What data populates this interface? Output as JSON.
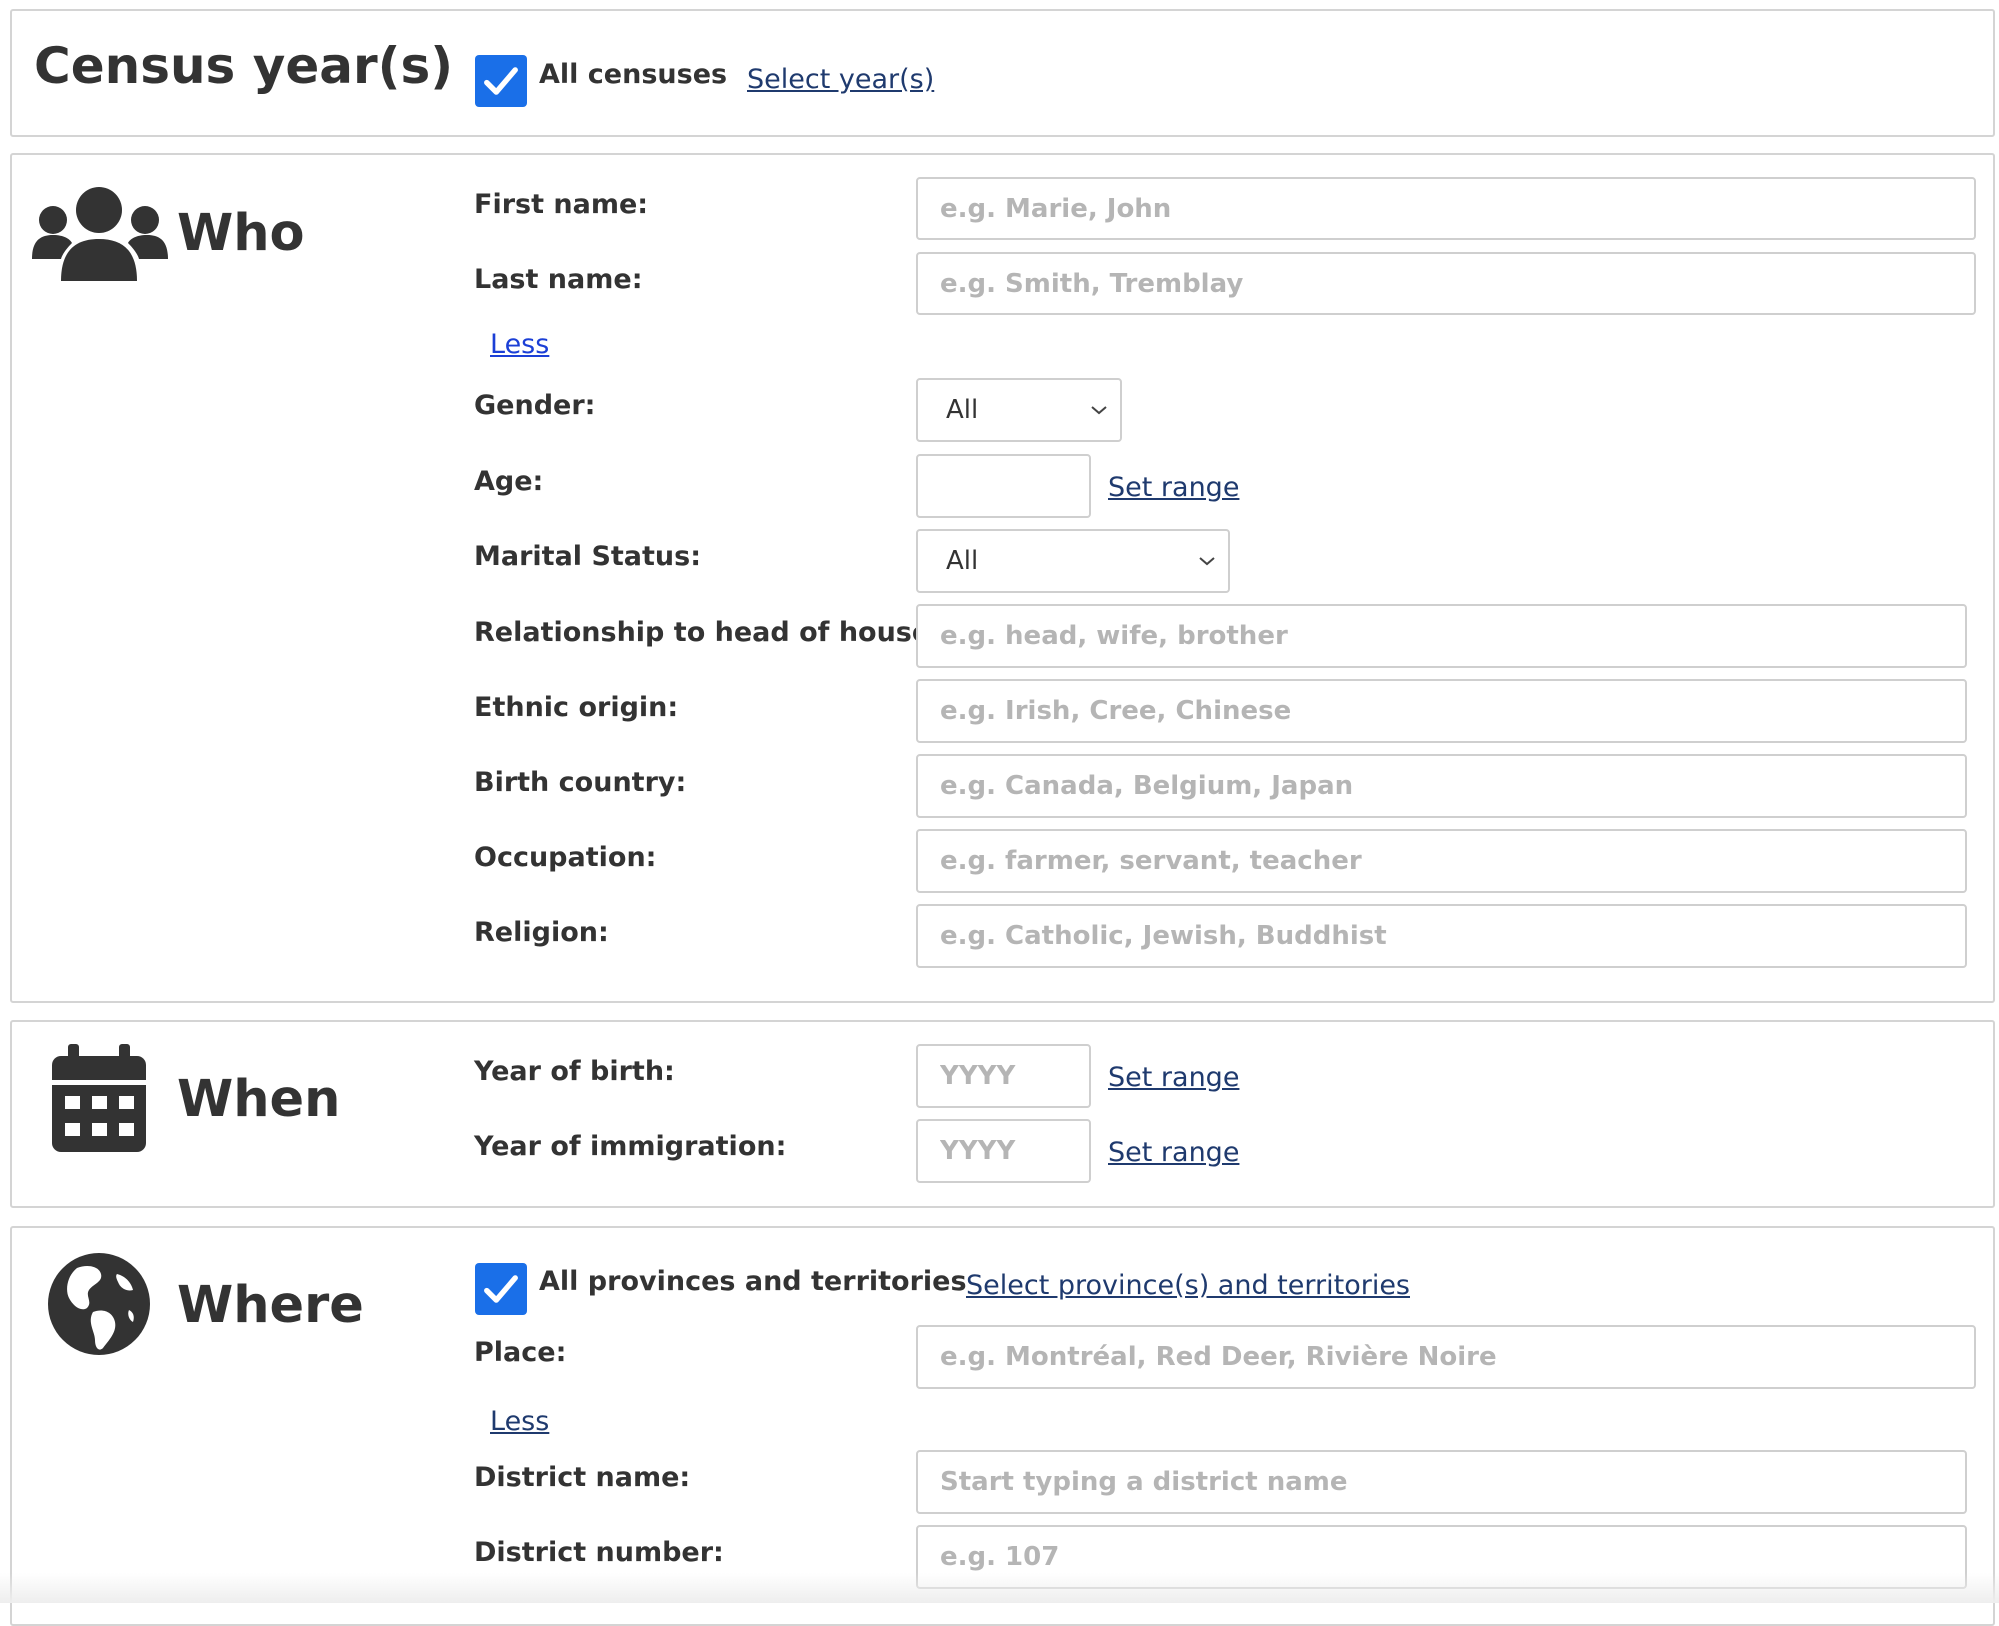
{
  "census": {
    "title": "Census year(s)",
    "all_label": "All censuses",
    "select_link": "Select year(s)"
  },
  "who": {
    "title": "Who",
    "first_name_label": "First name:",
    "first_name_placeholder": "e.g. Marie, John",
    "last_name_label": "Last name:",
    "last_name_placeholder": "e.g. Smith, Tremblay",
    "less_link": "Less",
    "gender_label": "Gender:",
    "gender_value": "All",
    "age_label": "Age:",
    "age_range_link": "Set range",
    "marital_label": "Marital Status:",
    "marital_value": "All",
    "relationship_label": "Relationship to head of house:",
    "relationship_placeholder": "e.g. head, wife, brother",
    "ethnic_label": "Ethnic origin:",
    "ethnic_placeholder": "e.g. Irish, Cree, Chinese",
    "birth_country_label": "Birth country:",
    "birth_country_placeholder": "e.g. Canada, Belgium, Japan",
    "occupation_label": "Occupation:",
    "occupation_placeholder": "e.g. farmer, servant, teacher",
    "religion_label": "Religion:",
    "religion_placeholder": "e.g. Catholic, Jewish, Buddhist"
  },
  "when": {
    "title": "When",
    "birth_year_label": "Year of birth:",
    "birth_year_placeholder": "YYYY",
    "birth_range_link": "Set range",
    "immigration_label": "Year of immigration:",
    "immigration_placeholder": "YYYY",
    "immigration_range_link": "Set range"
  },
  "where": {
    "title": "Where",
    "all_label": "All provinces and territories",
    "select_link": "Select province(s) and territories",
    "place_label": "Place:",
    "place_placeholder": "e.g. Montréal, Red Deer, Rivière Noire",
    "less_link": "Less",
    "district_name_label": "District name:",
    "district_name_placeholder": "Start typing a district name",
    "district_number_label": "District number:",
    "district_number_placeholder": "e.g. 107"
  },
  "icons": {
    "who": "users-icon",
    "when": "calendar-icon",
    "where": "globe-icon",
    "checkbox": "checkmark-icon",
    "select": "chevron-down-icon"
  },
  "colors": {
    "checkbox": "#1a6fe8",
    "link": "#1f3a6e",
    "active_link": "#1b3fd6",
    "placeholder": "#b5b5b5",
    "border": "#d4d4d4"
  }
}
